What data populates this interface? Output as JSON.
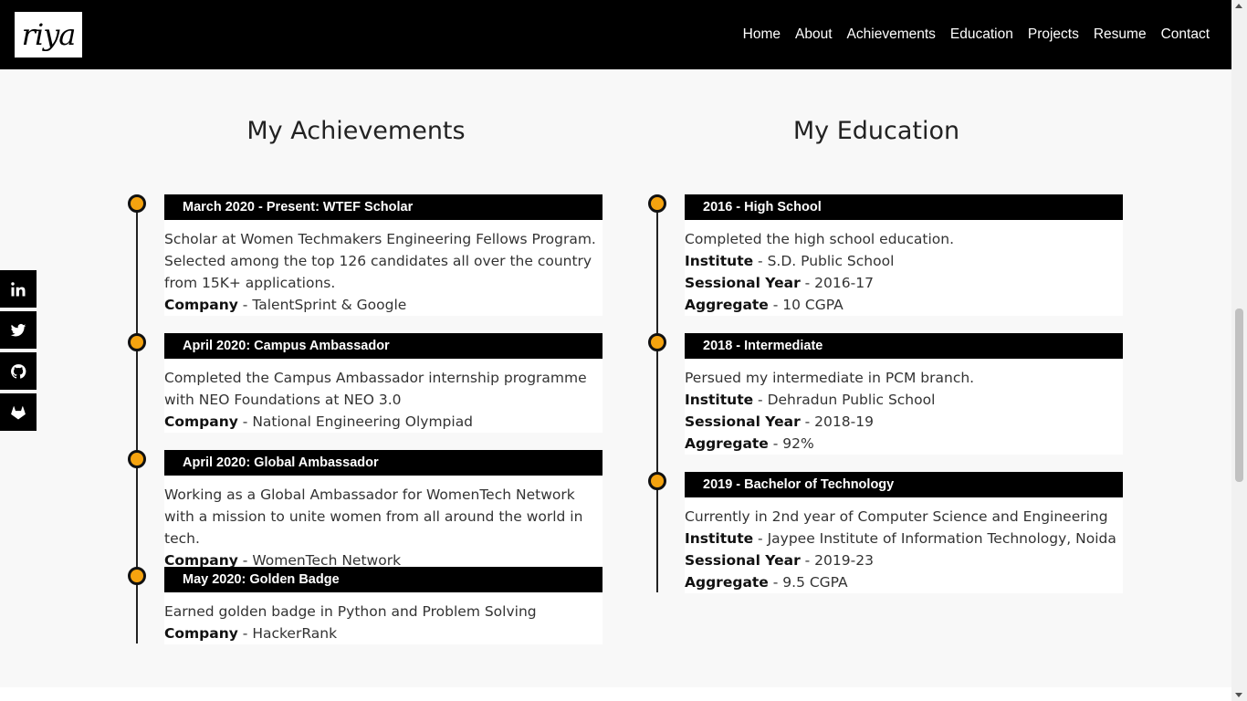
{
  "nav": {
    "logo_text": "riya",
    "links": [
      "Home",
      "About",
      "Achievements",
      "Education",
      "Projects",
      "Resume",
      "Contact"
    ]
  },
  "social": [
    "linkedin-icon",
    "twitter-icon",
    "github-icon",
    "gitlab-icon"
  ],
  "achievements": {
    "title": "My Achievements",
    "items": [
      {
        "heading": "March 2020 - Present: WTEF Scholar",
        "text": "Scholar at Women Techmakers Engineering Fellows Program. Selected among the top 126 candidates all over the country from 15K+ applications.",
        "company_label": "Company",
        "company": " - TalentSprint & Google"
      },
      {
        "heading": "April 2020: Campus Ambassador",
        "text": "Completed the Campus Ambassador internship programme with NEO Foundations at NEO 3.0",
        "company_label": "Company",
        "company": " - National Engineering Olympiad"
      },
      {
        "heading": "April 2020: Global Ambassador",
        "text": "Working as a Global Ambassador for WomenTech Network with a mission to unite women from all around the world in tech.",
        "company_label": "Company",
        "company": " - WomenTech Network"
      },
      {
        "heading": "May 2020: Golden Badge",
        "text": "Earned golden badge in Python and Problem Solving",
        "company_label": "Company",
        "company": " - HackerRank"
      }
    ]
  },
  "education": {
    "title": "My Education",
    "items": [
      {
        "heading": "2016 - High School",
        "text": "Completed the high school education.",
        "institute_label": "Institute",
        "institute": " - S.D. Public School",
        "year_label": "Sessional Year",
        "year": " - 2016-17",
        "aggregate_label": "Aggregate",
        "aggregate": " - 10 CGPA"
      },
      {
        "heading": "2018 - Intermediate",
        "text": "Persued my intermediate in PCM branch.",
        "institute_label": "Institute",
        "institute": " - Dehradun Public School",
        "year_label": "Sessional Year",
        "year": " - 2018-19",
        "aggregate_label": "Aggregate",
        "aggregate": " - 92%"
      },
      {
        "heading": "2019 - Bachelor of Technology",
        "text": "Currently in 2nd year of Computer Science and Engineering",
        "institute_label": "Institute",
        "institute": " - Jaypee Institute of Information Technology, Noida",
        "year_label": "Sessional Year",
        "year": " - 2019-23",
        "aggregate_label": "Aggregate",
        "aggregate": " - 9.5 CGPA"
      }
    ]
  },
  "colors": {
    "accent": "#f5a30f",
    "nav_bg": "#000000",
    "page_bg": "#f8f8f8"
  }
}
